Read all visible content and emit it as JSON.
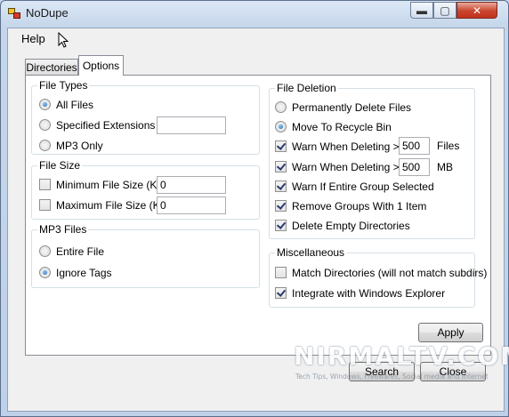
{
  "window": {
    "title": "NoDupe",
    "minimize_icon": "minimize-icon",
    "maximize_icon": "maximize-icon",
    "close_icon": "close-icon"
  },
  "menu": {
    "help": "Help"
  },
  "tabs": {
    "directories": "Directories",
    "options": "Options",
    "selected": "Options"
  },
  "file_types": {
    "title": "File Types",
    "all_files": "All Files",
    "specified_extensions": "Specified Extensions",
    "extensions_value": "",
    "mp3_only": "MP3 Only",
    "selected": "All Files"
  },
  "file_size": {
    "title": "File Size",
    "min_label": "Minimum File Size (KB)",
    "min_value": "0",
    "min_checked": false,
    "max_label": "Maximum File Size (KB)",
    "max_value": "0",
    "max_checked": false
  },
  "mp3_files": {
    "title": "MP3 Files",
    "entire_file": "Entire File",
    "ignore_tags": "Ignore Tags",
    "selected": "Ignore Tags"
  },
  "file_deletion": {
    "title": "File Deletion",
    "permanently_delete": "Permanently Delete Files",
    "move_to_recycle": "Move To Recycle Bin",
    "selected": "Move To Recycle Bin",
    "warn_files_label": "Warn When Deleting >",
    "warn_files_value": "500",
    "warn_files_unit": "Files",
    "warn_mb_label": "Warn When Deleting >",
    "warn_mb_value": "500",
    "warn_mb_unit": "MB",
    "warn_entire_group": "Warn If Entire Group Selected",
    "remove_groups": "Remove Groups With 1 Item",
    "delete_empty_dirs": "Delete Empty Directories"
  },
  "misc": {
    "title": "Miscellaneous",
    "match_directories": "Match Directories (will not match subdirs)",
    "integrate_explorer": "Integrate with Windows Explorer"
  },
  "buttons": {
    "apply": "Apply",
    "search": "Search",
    "close": "Close"
  },
  "watermark": {
    "brand": "NIRMALTV.COM",
    "tagline": "Tech Tips, Windows, Freewares, Social media and Internet"
  }
}
